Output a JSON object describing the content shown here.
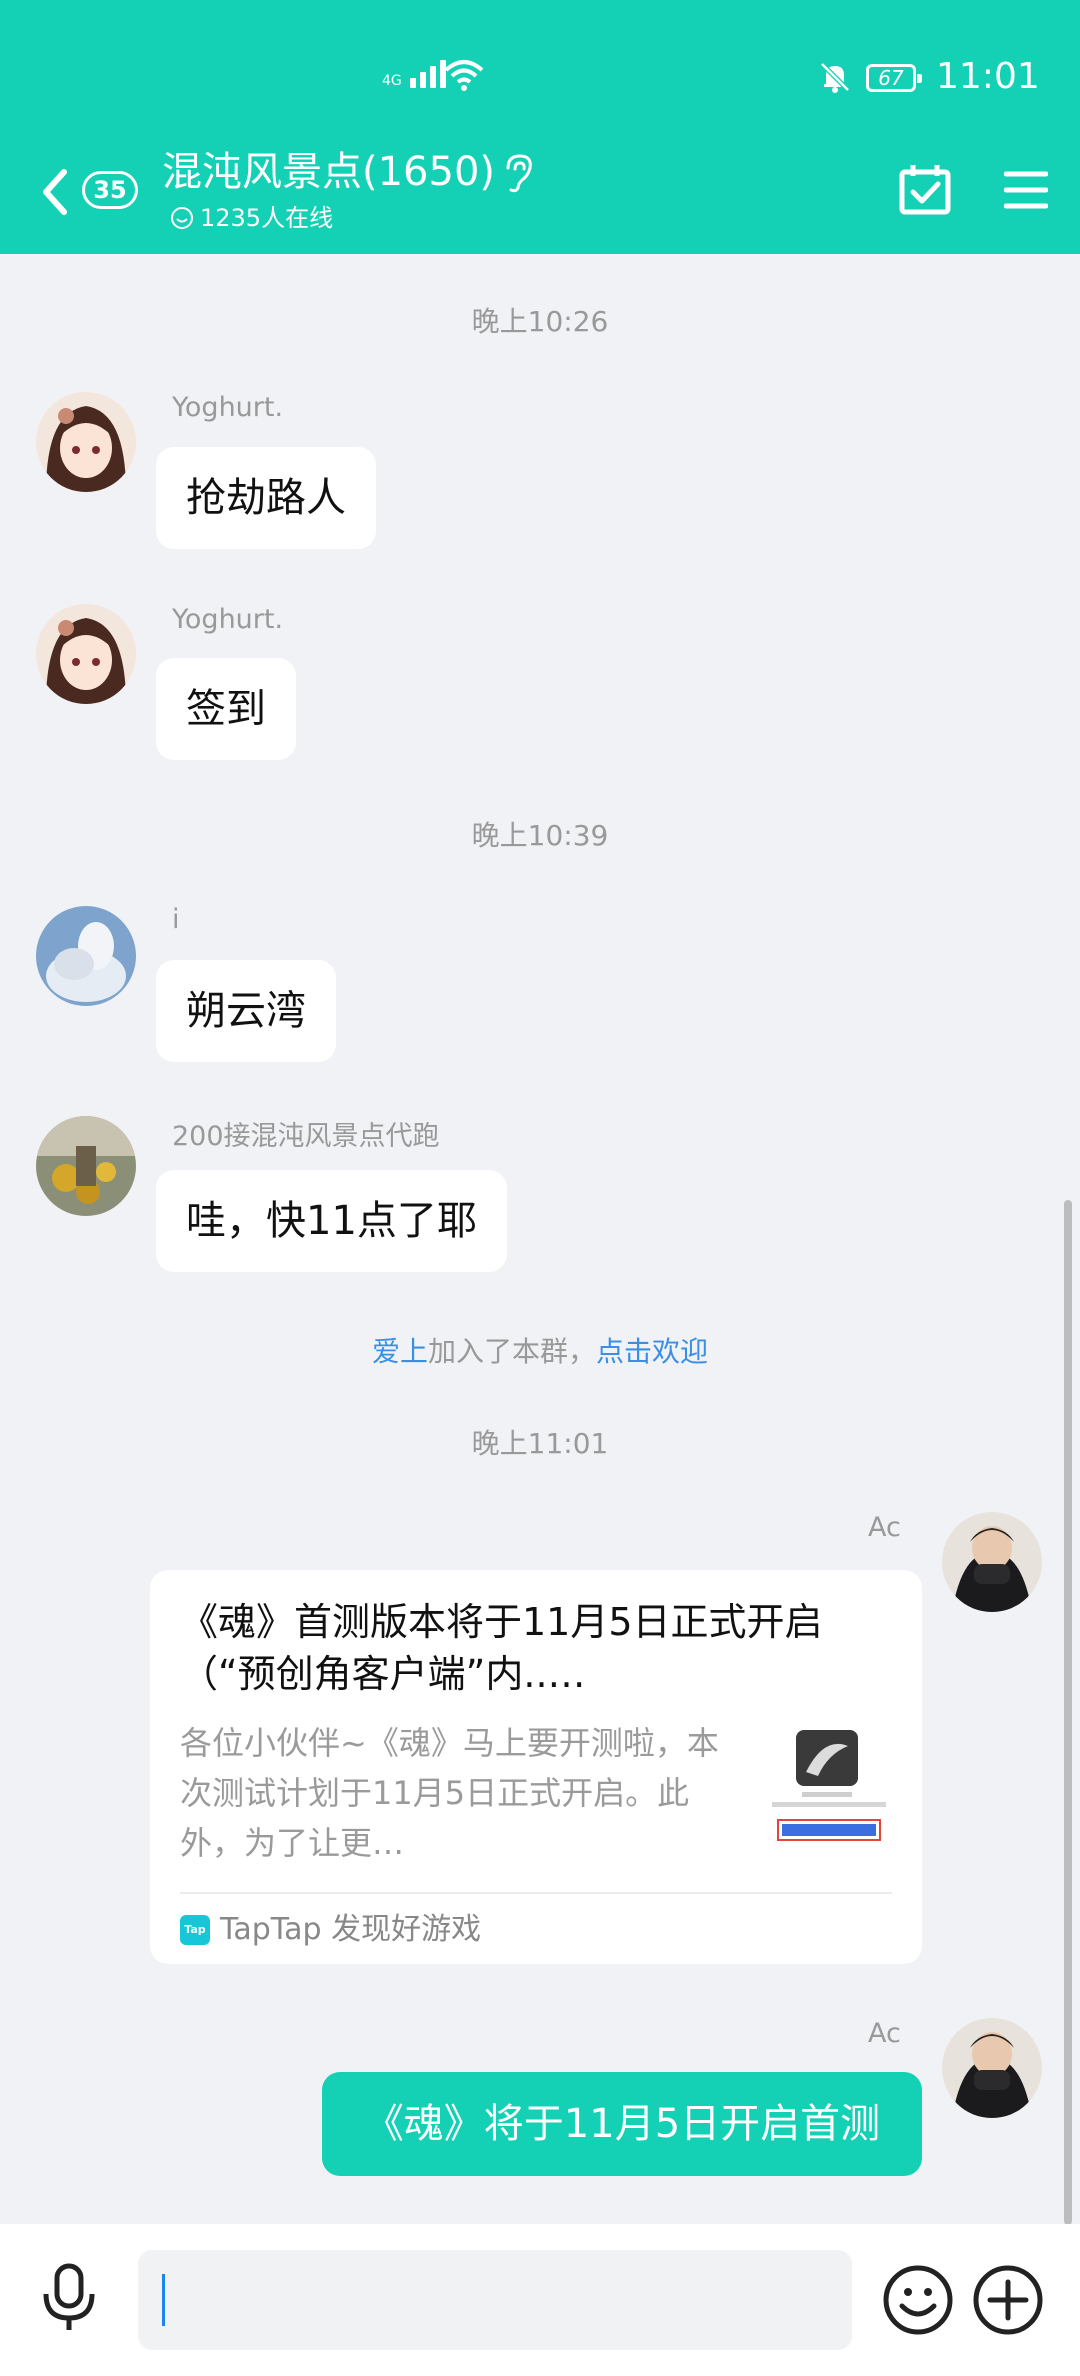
{
  "status_bar": {
    "network_tag": "4G",
    "battery": "67",
    "time": "11:01"
  },
  "header": {
    "unread_count": "35",
    "title": "混沌风景点(1650)",
    "online_text": "1235人在线"
  },
  "timestamps": [
    "晚上10:26",
    "晚上10:39",
    "晚上11:01"
  ],
  "messages": [
    {
      "sender": "Yoghurt.",
      "text": "抢劫路人"
    },
    {
      "sender": "Yoghurt.",
      "text": "签到"
    },
    {
      "sender": "i",
      "text": "朔云湾"
    },
    {
      "sender": "200接混沌风景点代跑",
      "text": "哇，快11点了耶"
    }
  ],
  "system": {
    "name": "爱上",
    "joined_text": "加入了本群，",
    "welcome_link": "点击欢迎"
  },
  "card_message": {
    "sender": "Ac",
    "title": "《魂》首测版本将于11月5日正式开启（“预创角客户端”内..…",
    "description": "各位小伙伴~《魂》马上要开测啦，本次测试计划于11月5日正式开启。此外，为了让更…",
    "source_logo": "Tap",
    "source": "TapTap 发现好游戏"
  },
  "sent_message": {
    "sender": "Ac",
    "text": "《魂》将于11月5日开启首测"
  },
  "input": {
    "value": ""
  },
  "colors": {
    "accent": "#14d1b6",
    "link": "#3a8ee6",
    "background": "#f1f2f6"
  }
}
